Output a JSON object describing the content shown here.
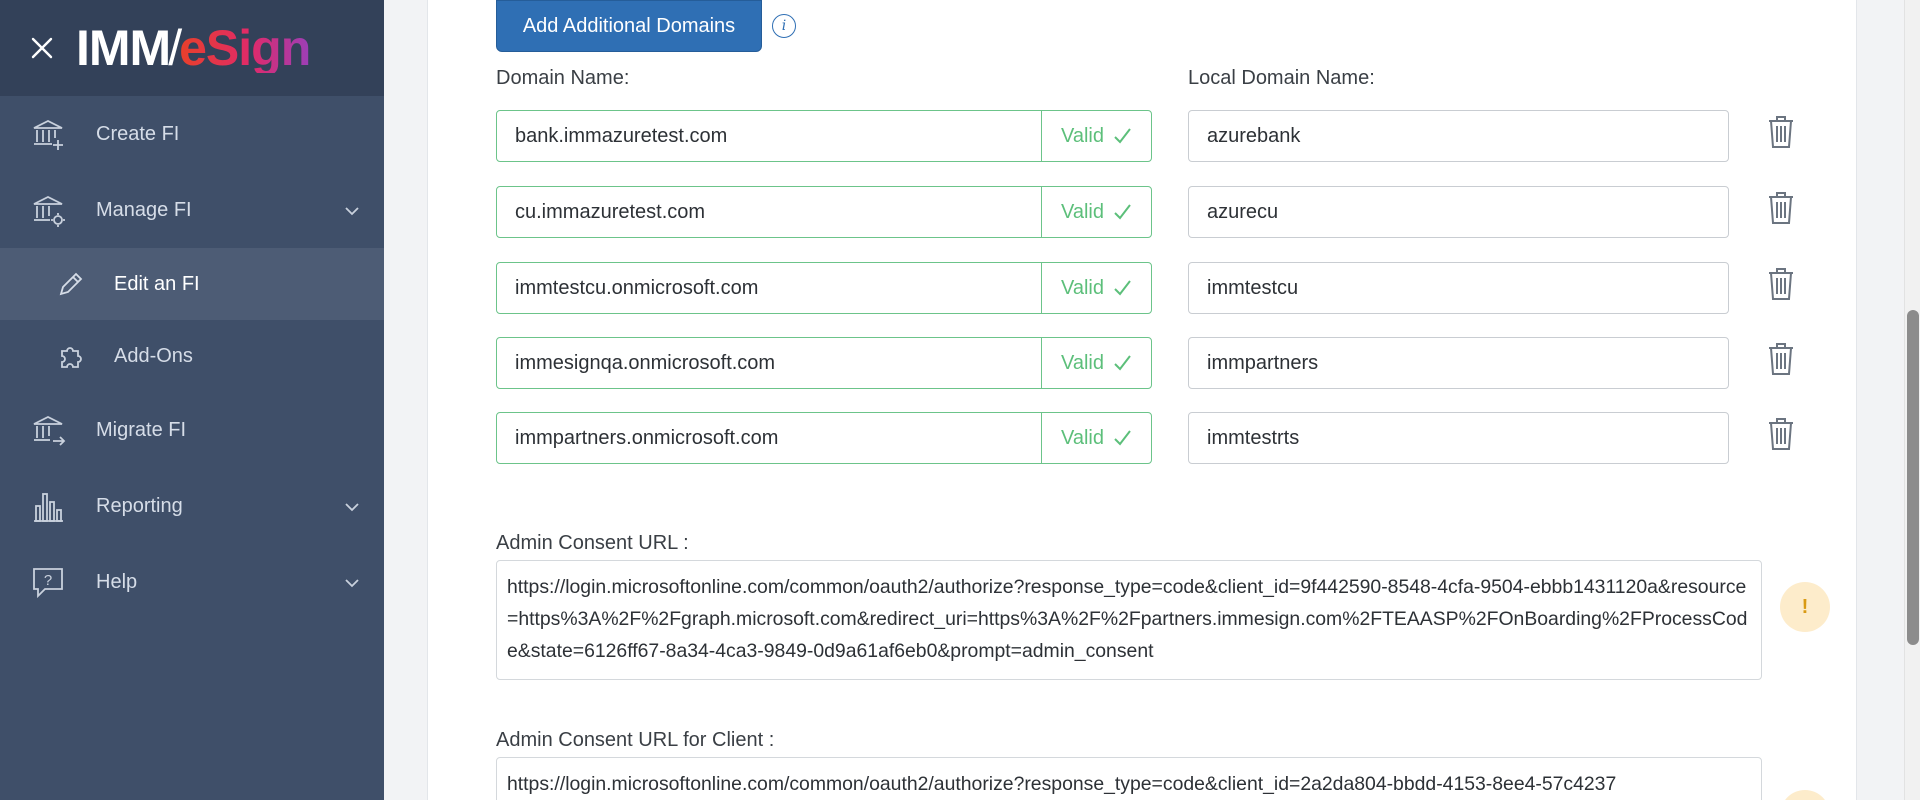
{
  "sidebar": {
    "logo": {
      "imm": "IMM",
      "slash": "/",
      "esign": "eSign"
    },
    "items": [
      {
        "label": "Create FI",
        "icon": "bank-plus-icon"
      },
      {
        "label": "Manage FI",
        "icon": "bank-gear-icon",
        "expanded": true
      },
      {
        "label": "Edit an FI",
        "icon": "pencil-icon",
        "active": true,
        "sub": true
      },
      {
        "label": "Add-Ons",
        "icon": "puzzle-icon",
        "sub": true
      },
      {
        "label": "Migrate FI",
        "icon": "bank-arrow-icon"
      },
      {
        "label": "Reporting",
        "icon": "bar-chart-icon",
        "expanded": false
      },
      {
        "label": "Help",
        "icon": "help-bubble-icon",
        "expanded": false
      }
    ]
  },
  "main": {
    "add_domains_button": "Add Additional Domains",
    "info_icon_label": "i",
    "domain_name_label": "Domain Name:",
    "local_domain_label": "Local Domain Name:",
    "status_valid": "Valid",
    "domains": [
      {
        "domain": "bank.immazuretest.com",
        "local": "azurebank"
      },
      {
        "domain": "cu.immazuretest.com",
        "local": "azurecu"
      },
      {
        "domain": "immtestcu.onmicrosoft.com",
        "local": "immtestcu"
      },
      {
        "domain": "immesignqa.onmicrosoft.com",
        "local": "immpartners"
      },
      {
        "domain": "immpartners.onmicrosoft.com",
        "local": "immtestrts"
      }
    ],
    "admin_consent_label": "Admin Consent URL :",
    "admin_consent_url": "https://login.microsoftonline.com/common/oauth2/authorize?response_type=code&client_id=9f442590-8548-4cfa-9504-ebbb1431120a&resource=https%3A%2F%2Fgraph.microsoft.com&redirect_uri=https%3A%2F%2Fpartners.immesign.com%2FTEAASP%2FOnBoarding%2FProcessCode&state=6126ff67-8a34-4ca3-9849-0d9a61af6eb0&prompt=admin_consent",
    "warning_symbol": "!",
    "admin_consent_client_label": "Admin Consent URL for Client :",
    "admin_consent_client_url": "https://login.microsoftonline.com/common/oauth2/authorize?response_type=code&client_id=2a2da804-bbdd-4153-8ee4-57c4237"
  },
  "colors": {
    "sidebar_bg": "#3f4f69",
    "sidebar_header_bg": "#334159",
    "sidebar_active_bg": "#4d5c75",
    "primary_button": "#2f6fb4",
    "valid_green": "#5cbf7a",
    "warning_bg": "#fdeccb"
  }
}
